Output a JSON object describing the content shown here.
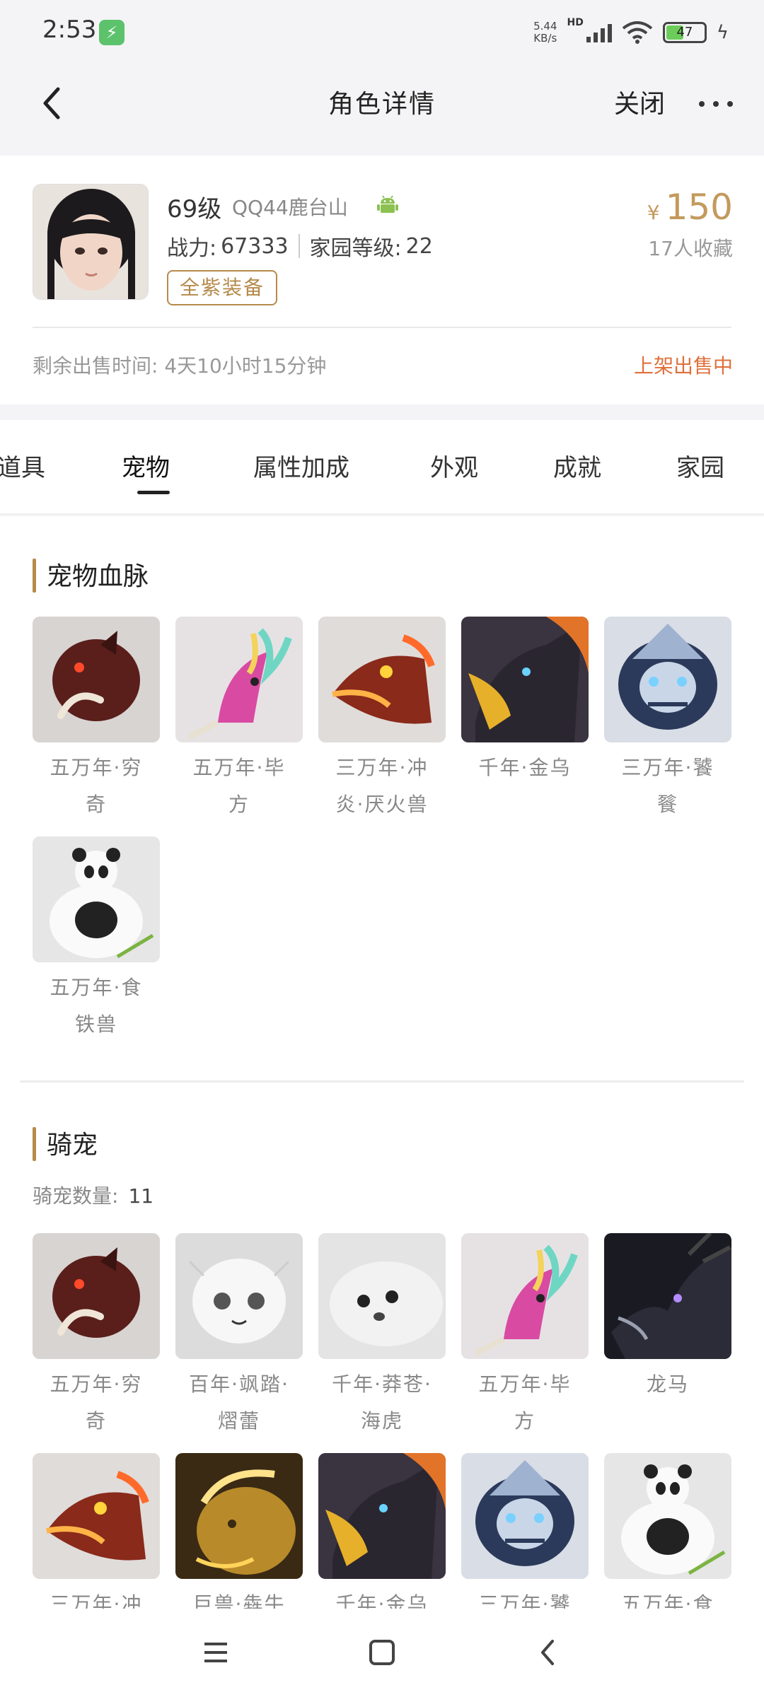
{
  "status_bar": {
    "time": "2:53",
    "net_speed": "5.44",
    "net_unit": "KB/s",
    "network_type": "HD",
    "battery": "47",
    "icons": [
      "charging-app-icon",
      "signal-icon",
      "wifi-icon",
      "battery-icon",
      "charging-icon"
    ]
  },
  "header": {
    "title": "角色详情",
    "close_label": "关闭",
    "icons": [
      "back-arrow-icon",
      "more-icon"
    ]
  },
  "profile": {
    "level": "69级",
    "server": "QQ44鹿台山",
    "platform_icon": "android-icon",
    "combat_label": "战力:",
    "combat_value": "67333",
    "home_label": "家园等级:",
    "home_value": "22",
    "badge": "全紫装备",
    "price_currency": "¥",
    "price": "150",
    "favorites": "17人收藏",
    "remaining_time": "剩余出售时间: 4天10小时15分钟",
    "status": "上架出售中"
  },
  "tabs": [
    {
      "label": "道具",
      "active": false
    },
    {
      "label": "宠物",
      "active": true
    },
    {
      "label": "属性加成",
      "active": false
    },
    {
      "label": "外观",
      "active": false
    },
    {
      "label": "成就",
      "active": false
    },
    {
      "label": "家园",
      "active": false
    }
  ],
  "sections": {
    "pet_bloodline": {
      "title": "宠物血脉",
      "pets": [
        {
          "name_line1": "五万年·穷",
          "name_line2": "奇",
          "image": "qiongqi-beast"
        },
        {
          "name_line1": "五万年·毕",
          "name_line2": "方",
          "image": "bifang-bird"
        },
        {
          "name_line1": "三万年·冲",
          "name_line2": "炎·厌火兽",
          "image": "fire-wolf"
        },
        {
          "name_line1": "千年·金乌",
          "name_line2": "",
          "image": "golden-crow"
        },
        {
          "name_line1": "三万年·饕",
          "name_line2": "餮",
          "image": "taotie-mask"
        },
        {
          "name_line1": "五万年·食",
          "name_line2": "铁兽",
          "image": "panda"
        }
      ]
    },
    "mounts": {
      "title": "骑宠",
      "count_label": "骑宠数量:",
      "count": "11",
      "pets": [
        {
          "name_line1": "五万年·穷",
          "name_line2": "奇",
          "image": "qiongqi-beast"
        },
        {
          "name_line1": "百年·飒踏·",
          "name_line2": "熠蕾",
          "image": "white-fluff"
        },
        {
          "name_line1": "千年·莽苍·",
          "name_line2": "海虎",
          "image": "seal"
        },
        {
          "name_line1": "五万年·毕",
          "name_line2": "方",
          "image": "bifang-bird"
        },
        {
          "name_line1": "龙马",
          "name_line2": "",
          "image": "dark-dragon"
        },
        {
          "name_line1": "三万年·冲",
          "name_line2": "",
          "image": "fire-wolf"
        },
        {
          "name_line1": "巨兽·犇牛",
          "name_line2": "",
          "image": "golden-bull"
        },
        {
          "name_line1": "千年·金乌",
          "name_line2": "",
          "image": "golden-crow"
        },
        {
          "name_line1": "三万年·饕",
          "name_line2": "",
          "image": "taotie-mask"
        },
        {
          "name_line1": "五万年·食",
          "name_line2": "",
          "image": "panda"
        }
      ]
    }
  },
  "nav_bar": {
    "icons": [
      "menu-icon",
      "home-icon",
      "back-icon"
    ]
  },
  "colors": {
    "accent_gold": "#b58a4b",
    "price_gold": "#c39a5c",
    "status_orange": "#e0703c",
    "background": "#f4f4f6"
  }
}
